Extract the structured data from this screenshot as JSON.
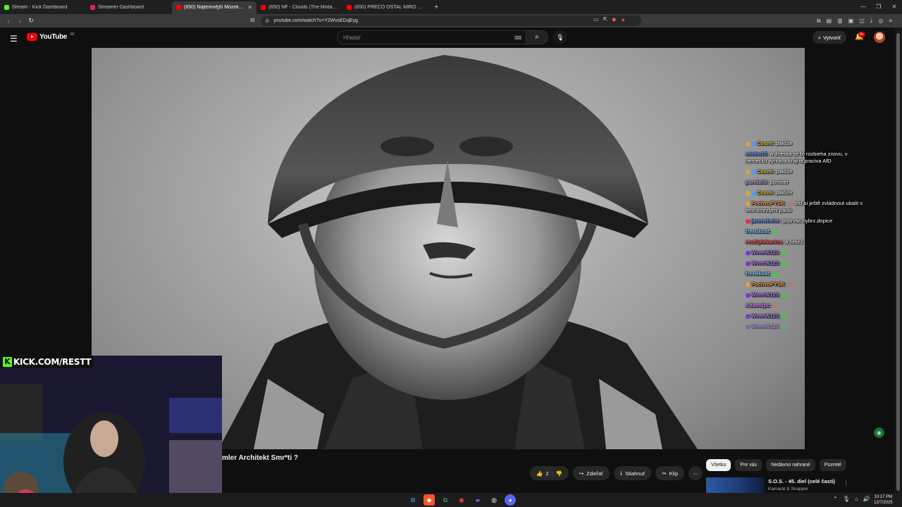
{
  "browser": {
    "tabs": [
      {
        "title": "Stream - Kick Dashboard",
        "color": "#53fc18",
        "active": false
      },
      {
        "title": "Streamer Dashboard",
        "color": "#e91e63",
        "active": false
      },
      {
        "title": "(650) Najtemnější Mozek Na",
        "color": "#ff0000",
        "active": true
      },
      {
        "title": "(650) NF - Clouds (The Mixtape) - Yo",
        "color": "#ff0000",
        "active": false
      },
      {
        "title": "(650) PREČO OSTAL MIRO POLONA",
        "color": "#ff0000",
        "active": false
      }
    ],
    "new_tab": "+",
    "url": "youtube.com/watch?v=Y2WvsEDqEyg"
  },
  "masthead": {
    "logo_text": "YouTube",
    "country": "SK",
    "search_placeholder": "Hľadať",
    "create_label": "Vytvoriť",
    "notification_count": "9+"
  },
  "chat": [
    {
      "nick": "Cosmi",
      "nick_color": "#f5c842",
      "text": "pakliže"
    },
    {
      "nick": "minho10",
      "nick_color": "#6aa4ff",
      "text": "a dneska se to rozbieha znovu, v nemecku vyhrava krajna praciva AfD"
    },
    {
      "nick": "Cosmi",
      "nick_color": "#f5c842",
      "text": "pakliže"
    },
    {
      "nick": "panda08",
      "nick_color": "#c0a0e0",
      "text": "pomiver"
    },
    {
      "nick": "Cosmi",
      "nick_color": "#f5c842",
      "text": "pakliže"
    },
    {
      "nick": "PochvoPYSK",
      "nick_color": "#ff9f45",
      "text": "teď si ještě zvládnout ubalit    s temi zmrzlymi packi"
    },
    {
      "nick": "jaronehehe",
      "nick_color": "#6aa4ff",
      "text": "poprvac,nybrz,dopice"
    },
    {
      "nick": "freedkoat",
      "nick_color": "#7fd0ff",
      "text": ""
    },
    {
      "nick": "restliplekanica",
      "nick_color": "#ff5f5f",
      "text": "a nebrž"
    },
    {
      "nick": "WeeeW123",
      "nick_color": "#b07cff",
      "text": ""
    },
    {
      "nick": "WeeeW123",
      "nick_color": "#b07cff",
      "text": ""
    },
    {
      "nick": "freedkoat",
      "nick_color": "#7fd0ff",
      "text": ""
    },
    {
      "nick": "PochvoPYSK",
      "nick_color": "#ff9f45",
      "text": ""
    },
    {
      "nick": "WeeeW123",
      "nick_color": "#b07cff",
      "text": ""
    },
    {
      "nick": "Adamdpc",
      "nick_color": "#d08bff",
      "text": ""
    },
    {
      "nick": "WeeeW123",
      "nick_color": "#b07cff",
      "text": ""
    },
    {
      "nick": "WeeeW123",
      "nick_color": "#b07cff",
      "text": ""
    }
  ],
  "overlay": {
    "kick_url": "KICK.COM/RESTT"
  },
  "video": {
    "title": "mler Architekt Smr*ti ?",
    "likes": "2",
    "share_label": "Zdieľať",
    "download_label": "Stiahnuť",
    "clip_label": "Klip",
    "more_label": "⋯"
  },
  "sidebar": {
    "chips": [
      "Všetko",
      "Pre vás",
      "Nedávno nahrané",
      "Pozreté"
    ],
    "recommendation_title": "S.O.S. - 45. diel (celé časti)",
    "recommendation_meta": "Kamarát & Snapper"
  },
  "taskbar": {
    "time": "10:17 PM",
    "date": "12/7/2025"
  }
}
